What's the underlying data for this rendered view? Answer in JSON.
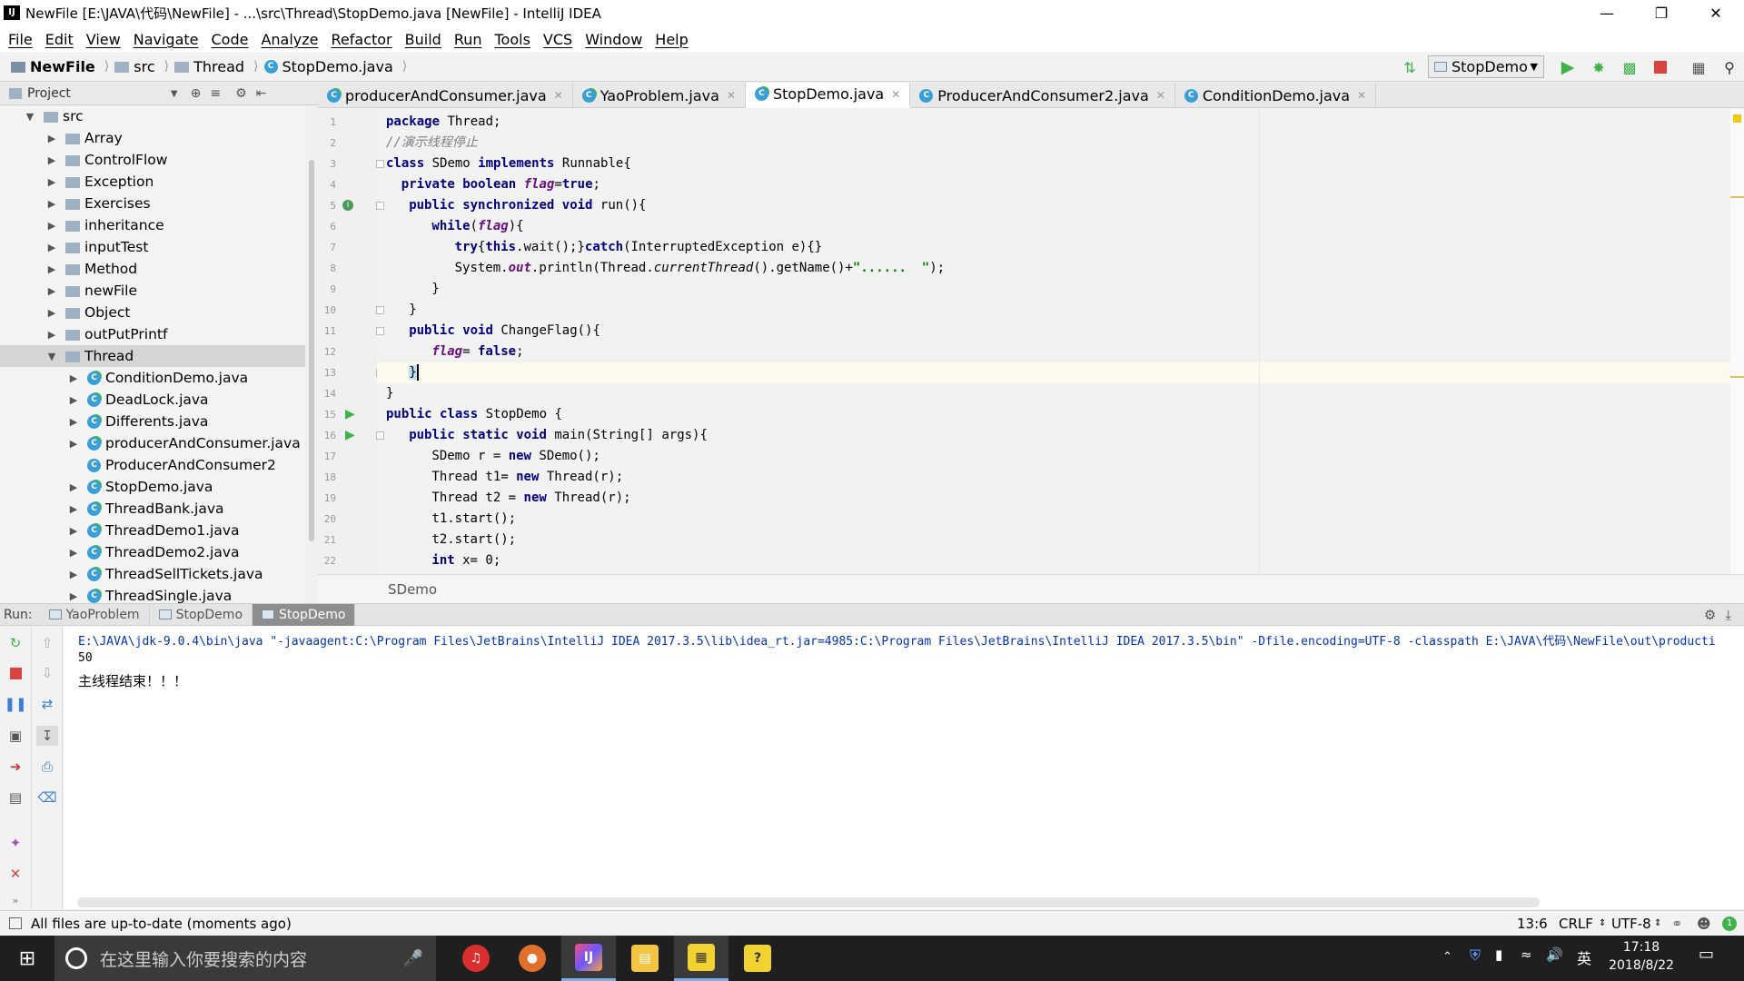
{
  "window": {
    "title": "NewFile [E:\\JAVA\\代码\\NewFile] - ...\\src\\Thread\\StopDemo.java [NewFile] - IntelliJ IDEA",
    "logo": "IJ"
  },
  "menu": [
    "File",
    "Edit",
    "View",
    "Navigate",
    "Code",
    "Analyze",
    "Refactor",
    "Build",
    "Run",
    "Tools",
    "VCS",
    "Window",
    "Help"
  ],
  "breadcrumb": [
    "NewFile",
    "src",
    "Thread",
    "StopDemo.java"
  ],
  "run_config": "StopDemo",
  "project": {
    "header": "Project",
    "root": "src",
    "items": [
      {
        "label": "Array",
        "kind": "folder"
      },
      {
        "label": "ControlFlow",
        "kind": "folder"
      },
      {
        "label": "Exception",
        "kind": "folder"
      },
      {
        "label": "Exercises",
        "kind": "folder"
      },
      {
        "label": "inheritance",
        "kind": "folder"
      },
      {
        "label": "inputTest",
        "kind": "folder"
      },
      {
        "label": "Method",
        "kind": "folder"
      },
      {
        "label": "newFile",
        "kind": "folder"
      },
      {
        "label": "Object",
        "kind": "folder"
      },
      {
        "label": "outPutPrintf",
        "kind": "folder"
      },
      {
        "label": "Thread",
        "kind": "folder-open"
      },
      {
        "label": "ConditionDemo.java",
        "kind": "class"
      },
      {
        "label": "DeadLock.java",
        "kind": "class"
      },
      {
        "label": "Differents.java",
        "kind": "class"
      },
      {
        "label": "producerAndConsumer.java",
        "kind": "class"
      },
      {
        "label": "ProducerAndConsumer2",
        "kind": "class"
      },
      {
        "label": "StopDemo.java",
        "kind": "class"
      },
      {
        "label": "ThreadBank.java",
        "kind": "class"
      },
      {
        "label": "ThreadDemo1.java",
        "kind": "class"
      },
      {
        "label": "ThreadDemo2.java",
        "kind": "class"
      },
      {
        "label": "ThreadSellTickets.java",
        "kind": "class"
      },
      {
        "label": "ThreadSingle.java",
        "kind": "class"
      }
    ]
  },
  "tabs": [
    "producerAndConsumer.java",
    "YaoProblem.java",
    "StopDemo.java",
    "ProducerAndConsumer2.java",
    "ConditionDemo.java"
  ],
  "active_tab": "StopDemo.java",
  "line_numbers": [
    "1",
    "2",
    "3",
    "4",
    "5",
    "6",
    "7",
    "8",
    "9",
    "10",
    "11",
    "12",
    "13",
    "14",
    "15",
    "16",
    "17",
    "18",
    "19",
    "20",
    "21",
    "22"
  ],
  "code": {
    "l1": [
      "package",
      " Thread;"
    ],
    "l2": "//演示线程停止",
    "l3": [
      "class",
      " SDemo ",
      "implements",
      " Runnable{"
    ],
    "l4": [
      "private boolean",
      " ",
      "flag",
      "=",
      "true",
      ";"
    ],
    "l5": [
      "public synchronized void",
      " run(){"
    ],
    "l6": [
      "while",
      "(",
      "flag",
      "){"
    ],
    "l7": [
      "try",
      "{",
      "this",
      ".wait();}",
      "catch",
      "(InterruptedException e){}"
    ],
    "l8": [
      "System.",
      "out",
      ".println(Thread.",
      "currentThread",
      "().getName()+",
      "\"......  \"",
      ");"
    ],
    "l9": "}",
    "l10": "}",
    "l11": [
      "public void",
      " ChangeFlag(){"
    ],
    "l12": [
      "flag",
      "= ",
      "false",
      ";"
    ],
    "l13": "}",
    "l14": "}",
    "l15": [
      "public class",
      " StopDemo {"
    ],
    "l16": [
      "public static void",
      " main(String[] args){"
    ],
    "l17": [
      "SDemo r = ",
      "new",
      " SDemo();"
    ],
    "l18": [
      "Thread t1= ",
      "new",
      " Thread(r);"
    ],
    "l19": [
      "Thread t2 = ",
      "new",
      " Thread(r);"
    ],
    "l20": "t1.start();",
    "l21": "t2.start();",
    "l22": [
      "int",
      " x= 0;"
    ]
  },
  "editor_breadcrumb": "SDemo",
  "run": {
    "label": "Run:",
    "tabs": [
      "YaoProblem",
      "StopDemo",
      "StopDemo"
    ],
    "console": [
      "E:\\JAVA\\jdk-9.0.4\\bin\\java \"-javaagent:C:\\Program Files\\JetBrains\\IntelliJ IDEA 2017.3.5\\lib\\idea_rt.jar=4985:C:\\Program Files\\JetBrains\\IntelliJ IDEA 2017.3.5\\bin\" -Dfile.encoding=UTF-8 -classpath E:\\JAVA\\代码\\NewFile\\out\\producti",
      "50",
      "主线程结束！！！"
    ]
  },
  "status": {
    "message": "All files are up-to-date (moments ago)",
    "position": "13:6",
    "line_sep": "CRLF",
    "encoding": "UTF-8"
  },
  "taskbar": {
    "search_placeholder": "在这里输入你要搜索的内容",
    "ime": "英",
    "time": "17:18",
    "date": "2018/8/22"
  },
  "colors": {
    "keyword": "#000080",
    "string": "#008000",
    "field": "#660e7a",
    "comment": "#808080",
    "console_cmd": "#0033b3",
    "class_badge": "#3a9fd6",
    "run_green": "#3fb24a",
    "stop_red": "#d9443f"
  }
}
